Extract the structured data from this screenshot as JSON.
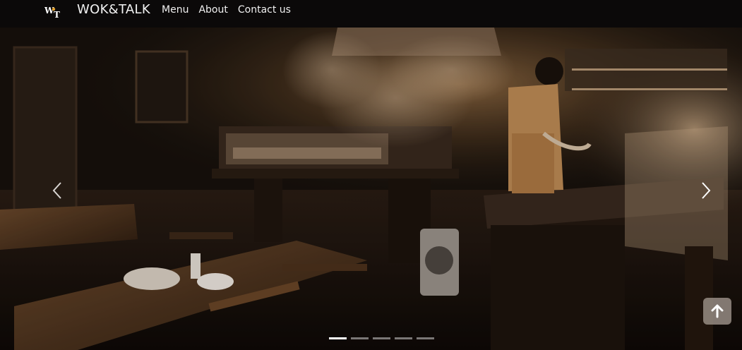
{
  "header": {
    "brand": "WOK&TALK",
    "nav": [
      "Menu",
      "About",
      "Contact us"
    ]
  },
  "hero": {
    "slides_count": 5,
    "active_slide": 1,
    "icons": {
      "prev": "chevron-left-icon",
      "next": "chevron-right-icon",
      "to_top": "arrow-up-icon"
    }
  },
  "colors": {
    "navbar_bg": "#0b0909",
    "active_indicator": "#ffffff",
    "inactive_indicator": "#8a8583",
    "to_top_bg": "#968c84"
  }
}
